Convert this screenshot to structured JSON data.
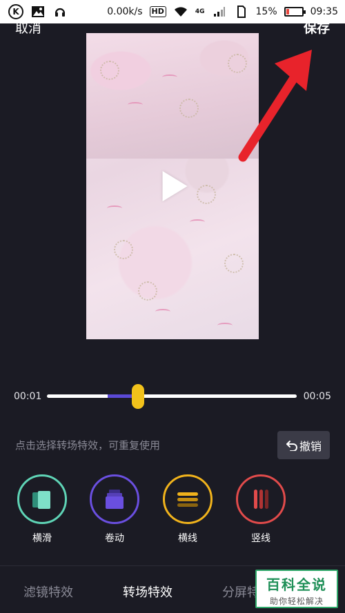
{
  "status_bar": {
    "speed": "0.00k/s",
    "network": "HD",
    "cellular": "4G",
    "battery_percent": "15%",
    "battery_level": 0.15,
    "time": "09:35",
    "icons": [
      "k-app-icon",
      "image-icon",
      "headphones-icon",
      "wifi-icon",
      "signal-icon",
      "sim-icon",
      "battery-icon"
    ]
  },
  "header": {
    "cancel_label": "取消",
    "save_label": "保存"
  },
  "video": {
    "play_icon": "play-icon"
  },
  "timeline": {
    "start_time": "00:01",
    "end_time": "00:05",
    "progress": 0.36,
    "transition_segment": [
      0.24,
      0.36
    ],
    "fill_color": "#5b49d6",
    "thumb_color": "#f2c21b"
  },
  "hint": {
    "text": "点击选择转场特效，可重复使用",
    "undo_label": "撤销",
    "undo_icon": "undo-icon"
  },
  "effects": [
    {
      "label": "横滑",
      "icon": "slide-icon",
      "color": "#5fd4b6"
    },
    {
      "label": "卷动",
      "icon": "scroll-icon",
      "color": "#6a4fe0"
    },
    {
      "label": "横线",
      "icon": "horizontal-lines-icon",
      "color": "#f1b31c"
    },
    {
      "label": "竖线",
      "icon": "vertical-lines-icon",
      "color": "#e14b4b"
    }
  ],
  "tabs": [
    {
      "label": "滤镜特效",
      "active": false
    },
    {
      "label": "转场特效",
      "active": true
    },
    {
      "label": "分屏特效",
      "active": false
    }
  ],
  "watermark": {
    "main": "百科全说",
    "sub": "助你轻松解决"
  },
  "colors": {
    "background": "#1b1b24",
    "annotation_arrow": "#e8232b"
  }
}
